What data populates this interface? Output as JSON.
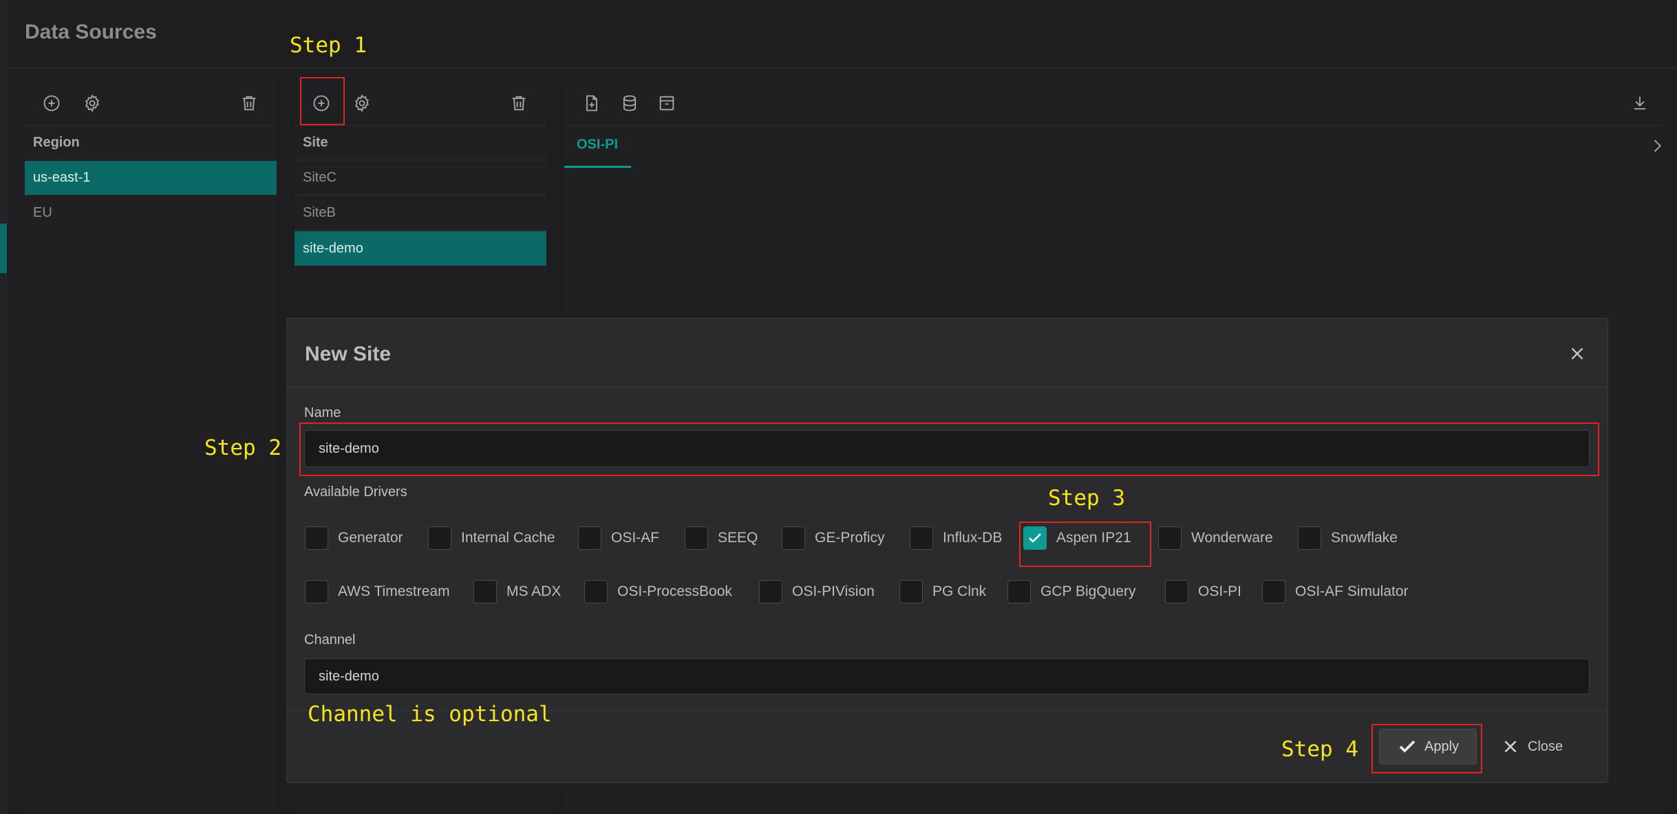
{
  "page": {
    "title": "Data Sources"
  },
  "region_panel": {
    "header": "Region",
    "items": [
      {
        "label": "us-east-1",
        "selected": true
      },
      {
        "label": "EU",
        "selected": false
      }
    ]
  },
  "site_panel": {
    "header": "Site",
    "items": [
      {
        "label": "SiteC",
        "selected": false
      },
      {
        "label": "SiteB",
        "selected": false
      },
      {
        "label": "site-demo",
        "selected": true
      }
    ]
  },
  "detail_panel": {
    "tabs": [
      {
        "label": "OSI-PI",
        "active": true
      }
    ]
  },
  "annotations": {
    "step1": "Step 1",
    "step2": "Step 2",
    "step3": "Step 3",
    "step4": "Step 4",
    "channel_note": "Channel is optional"
  },
  "dialog": {
    "title": "New Site",
    "name_label": "Name",
    "name_value": "site-demo",
    "drivers_label": "Available Drivers",
    "drivers": [
      {
        "label": "Generator",
        "checked": false
      },
      {
        "label": "Internal Cache",
        "checked": false
      },
      {
        "label": "OSI-AF",
        "checked": false
      },
      {
        "label": "SEEQ",
        "checked": false
      },
      {
        "label": "GE-Proficy",
        "checked": false
      },
      {
        "label": "Influx-DB",
        "checked": false
      },
      {
        "label": "Aspen IP21",
        "checked": true
      },
      {
        "label": "Wonderware",
        "checked": false
      },
      {
        "label": "Snowflake",
        "checked": false
      },
      {
        "label": "AWS Timestream",
        "checked": false
      },
      {
        "label": "MS ADX",
        "checked": false
      },
      {
        "label": "OSI-ProcessBook",
        "checked": false
      },
      {
        "label": "OSI-PIVision",
        "checked": false
      },
      {
        "label": "PG Clnk",
        "checked": false
      },
      {
        "label": "GCP BigQuery",
        "checked": false
      },
      {
        "label": "OSI-PI",
        "checked": false
      },
      {
        "label": "OSI-AF Simulator",
        "checked": false
      }
    ],
    "channel_label": "Channel",
    "channel_value": "site-demo",
    "apply_label": "Apply",
    "close_label": "Close"
  },
  "icons": {
    "add": "add-circle-icon",
    "settings": "gear-icon",
    "delete": "trash-icon",
    "new_file": "file-plus-icon",
    "database": "database-icon",
    "archive": "archive-icon",
    "download": "download-icon",
    "chevron": "chevron-right-icon"
  },
  "colors": {
    "accent": "#0f9b94",
    "selection": "#0b6a66",
    "annotation_box": "#e02424",
    "annotation_text": "#f5e520"
  }
}
